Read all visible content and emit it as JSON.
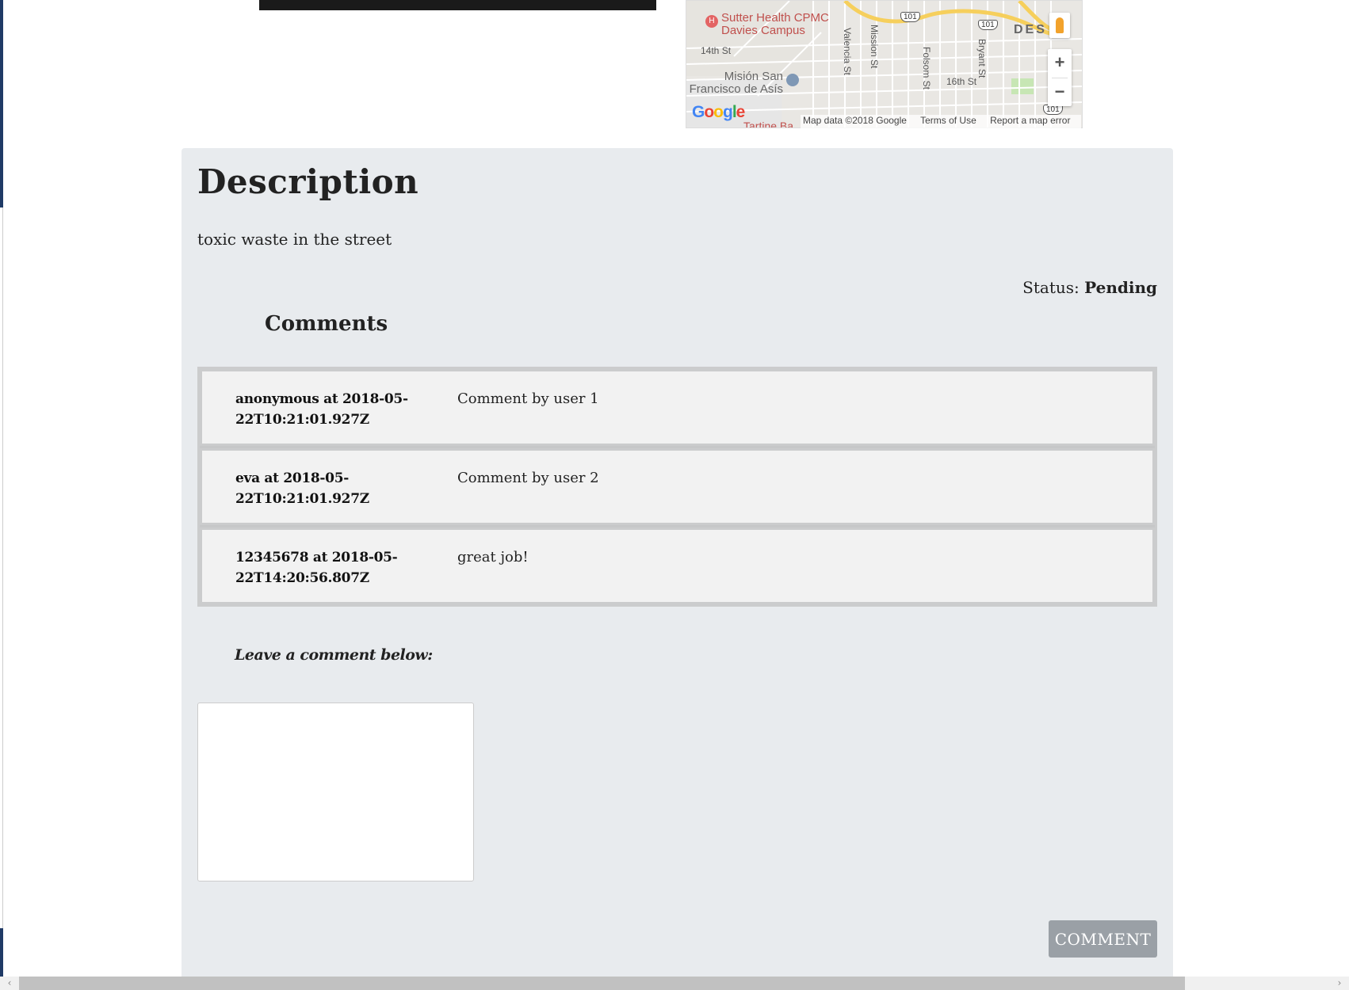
{
  "map": {
    "poi_hospital_line1": "Sutter Health CPMC",
    "poi_hospital_line2": "Davies Campus",
    "poi_mission_line1": "Misión San",
    "poi_mission_line2": "Francisco de Asís",
    "poi_tartine": "Tartine Ba",
    "streets": {
      "s14th": "14th St",
      "s16th": "16th St",
      "valencia": "Valencia St",
      "mission": "Mission St",
      "folsom": "Folsom St",
      "bryant": "Bryant St"
    },
    "highway": "101",
    "district": "DES",
    "zoom_in": "+",
    "zoom_out": "−",
    "logo": "Google",
    "footer": {
      "data": "Map data ©2018 Google",
      "terms": "Terms of Use",
      "report": "Report a map error"
    }
  },
  "description": {
    "title": "Description",
    "text": "toxic waste in the street"
  },
  "status": {
    "label": "Status:",
    "value": "Pending"
  },
  "comments": {
    "title": "Comments",
    "items": [
      {
        "meta": "anonymous at 2018-05-22T10:21:01.927Z",
        "text": "Comment by user 1"
      },
      {
        "meta": "eva at 2018-05-22T10:21:01.927Z",
        "text": "Comment by user 2"
      },
      {
        "meta": "12345678 at 2018-05-22T14:20:56.807Z",
        "text": "great job!"
      }
    ]
  },
  "form": {
    "leave_label": "Leave a comment below:",
    "input_value": "",
    "submit_label": "COMMENT"
  },
  "scrollbar": {
    "left_arrow": "‹",
    "right_arrow": "›"
  }
}
